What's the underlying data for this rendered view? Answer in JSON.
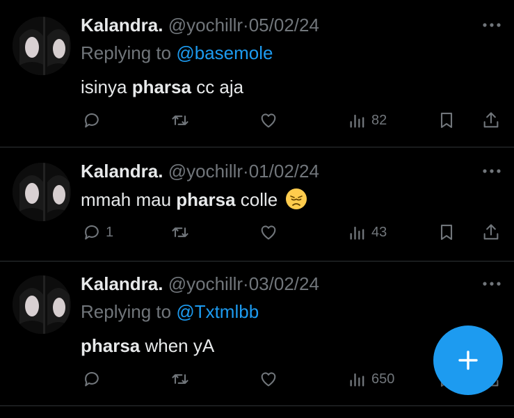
{
  "tweets": [
    {
      "name": "Kalandra.",
      "handle": "@yochillr",
      "separator": "·",
      "date": "05/02/24",
      "reply_prefix": "Replying to ",
      "reply_to": "@basemole",
      "text_pre": "isinya ",
      "text_bold": "pharsa",
      "text_post": " cc aja",
      "views": "82",
      "replies": ""
    },
    {
      "name": "Kalandra.",
      "handle": "@yochillr",
      "separator": "·",
      "date": "01/02/24",
      "text_pre": "mmah mau ",
      "text_bold": "pharsa",
      "text_post": " colle",
      "emoji": "disappointed-face",
      "views": "43",
      "replies": "1"
    },
    {
      "name": "Kalandra.",
      "handle": "@yochillr",
      "separator": "·",
      "date": "03/02/24",
      "reply_prefix": "Replying to ",
      "reply_to": "@Txtmlbb",
      "text_pre": "",
      "text_bold": "pharsa",
      "text_post": " when yA",
      "views": "650",
      "replies": ""
    }
  ],
  "colors": {
    "background": "#000000",
    "text": "#e7e9ea",
    "muted": "#71767b",
    "accent": "#1d9bf0",
    "divider": "#2f3336"
  },
  "icons": [
    "reply-icon",
    "retweet-icon",
    "like-icon",
    "views-icon",
    "bookmark-icon",
    "share-icon",
    "more-icon",
    "compose-icon"
  ]
}
